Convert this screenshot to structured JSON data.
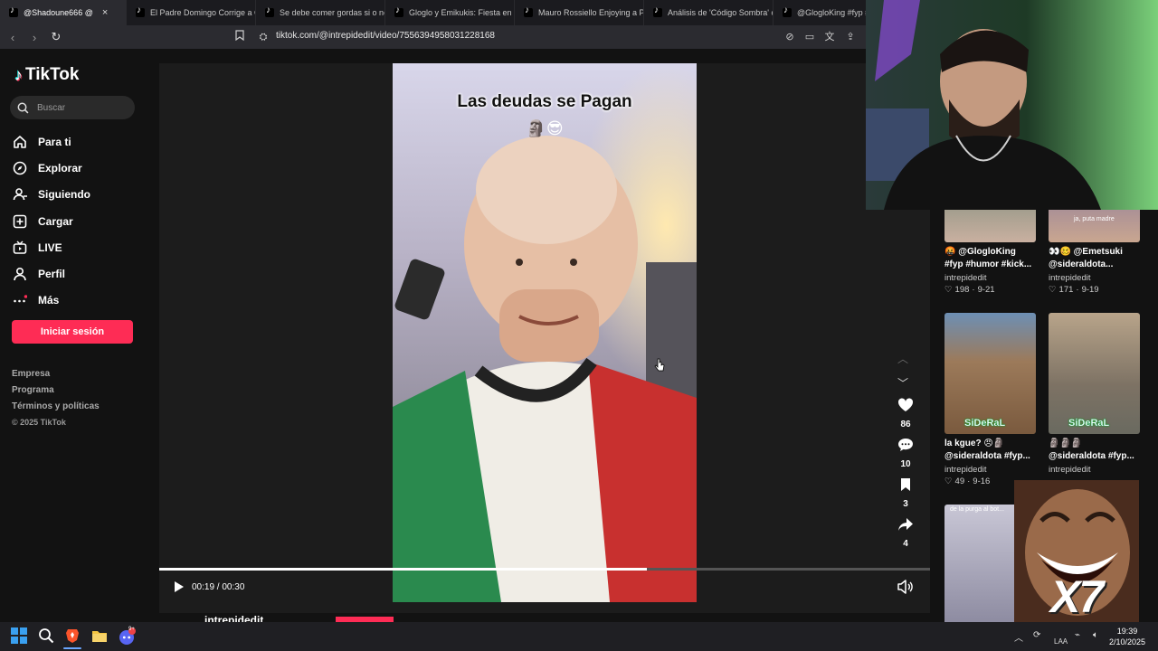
{
  "browser": {
    "tabs": [
      {
        "label": "@Shadoune666 @",
        "active": true,
        "close": "×"
      },
      {
        "label": "El Padre Domingo Corrige a Gl..."
      },
      {
        "label": "Se debe comer gordas si o no?"
      },
      {
        "label": "Gloglo y Emikukis: Fiesta en la"
      },
      {
        "label": "Mauro Rossiello Enjoying a Poc"
      },
      {
        "label": "Análisis de 'Código Sombra' co"
      },
      {
        "label": "@GlogloKing #fyp #g"
      }
    ],
    "url": "tiktok.com/@intrepidedit/video/7556394958031228168"
  },
  "sidebar": {
    "logo_text": "TikTok",
    "search_placeholder": "Buscar",
    "nav": [
      {
        "label": "Para ti",
        "icon": "home-icon"
      },
      {
        "label": "Explorar",
        "icon": "compass-icon"
      },
      {
        "label": "Siguiendo",
        "icon": "following-icon"
      },
      {
        "label": "Cargar",
        "icon": "upload-icon"
      },
      {
        "label": "LIVE",
        "icon": "live-icon"
      },
      {
        "label": "Perfil",
        "icon": "profile-icon"
      },
      {
        "label": "Más",
        "icon": "more-icon"
      }
    ],
    "login_button": "Iniciar sesión",
    "footer": {
      "empresa": "Empresa",
      "programa": "Programa",
      "terminos": "Términos y políticas",
      "copyright": "© 2025 TikTok"
    }
  },
  "video": {
    "caption": "Las deudas se Pagan",
    "caption_emojis": "🗿😎",
    "time": "00:19 / 00:30",
    "progress": 0.633,
    "likes": "86",
    "comments": "10",
    "saves": "3",
    "shares": "4",
    "author": "intrepidedit"
  },
  "related": [
    {
      "title": "🤬 @GlogloKing #fyp #humor #kick...",
      "author": "intrepidedit",
      "likes": "198",
      "date": "9-21"
    },
    {
      "title": "👀🥴 @Emetsuki @sideraldota...",
      "author": "intrepidedit",
      "likes": "171",
      "date": "9-19",
      "overlay": "ja, puta madre"
    },
    {
      "title": "la kgue? 😠🗿",
      "title2": "@sideraldota #fyp...",
      "author": "intrepidedit",
      "likes": "49",
      "date": "9-16",
      "badge": "SiDeRaL"
    },
    {
      "title": "🗿🗿🗿",
      "title2": "@sideraldota #fyp...",
      "author": "intrepidedit",
      "badge": "SiDeRaL"
    },
    {
      "overlay": "de la purga al bot..."
    }
  ],
  "meme_overlay": "X7",
  "taskbar": {
    "time": "19:39",
    "date": "2/10/2025",
    "lang": "LAA",
    "discord_badge": "9+"
  }
}
